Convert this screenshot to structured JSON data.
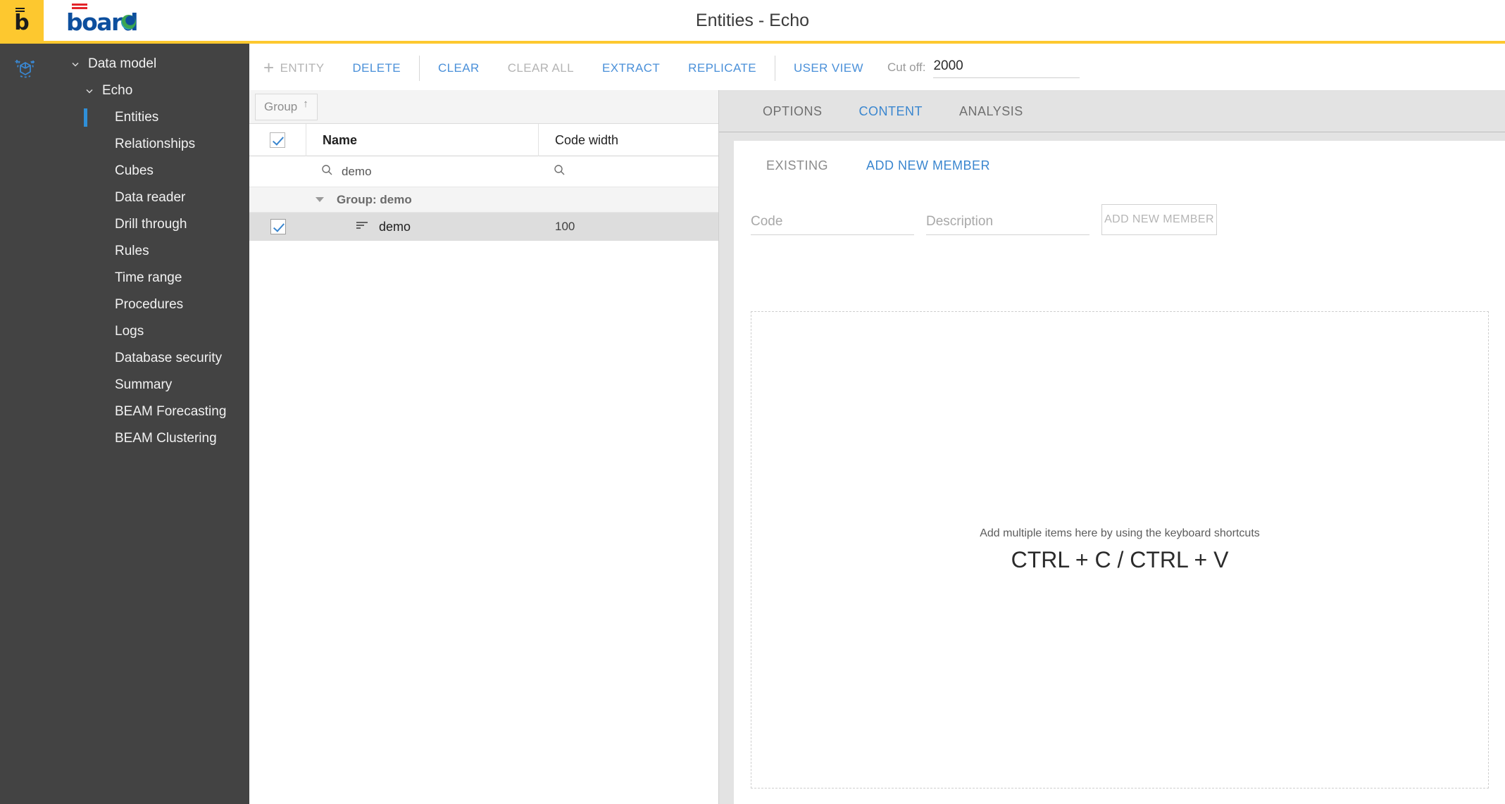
{
  "header": {
    "brand_mark": "b",
    "logo_text": "board",
    "title": "Entities - Echo"
  },
  "colors": {
    "brand_yellow": "#fdc82f",
    "sidebar_bg": "#434343",
    "accent_blue": "#3a86cf",
    "logo_blue": "#0d4f9e",
    "logo_red": "#e3242b",
    "selection_row": "#dddddd"
  },
  "sidebar": {
    "emblem_icon": "cube-sparkle-icon",
    "items": [
      {
        "label": "Data model",
        "level": 0,
        "expanded": true,
        "selected": false
      },
      {
        "label": "Echo",
        "level": 1,
        "expanded": true,
        "selected": false
      },
      {
        "label": "Entities",
        "level": 2,
        "selected": true
      },
      {
        "label": "Relationships",
        "level": 2,
        "selected": false
      },
      {
        "label": "Cubes",
        "level": 2,
        "selected": false
      },
      {
        "label": "Data reader",
        "level": 2,
        "selected": false
      },
      {
        "label": "Drill through",
        "level": 2,
        "selected": false
      },
      {
        "label": "Rules",
        "level": 2,
        "selected": false
      },
      {
        "label": "Time range",
        "level": 2,
        "selected": false
      },
      {
        "label": "Procedures",
        "level": 2,
        "selected": false
      },
      {
        "label": "Logs",
        "level": 2,
        "selected": false
      },
      {
        "label": "Database security",
        "level": 2,
        "selected": false
      },
      {
        "label": "Summary",
        "level": 2,
        "selected": false
      },
      {
        "label": "BEAM Forecasting",
        "level": 2,
        "selected": false
      },
      {
        "label": "BEAM Clustering",
        "level": 2,
        "selected": false
      }
    ]
  },
  "toolbar": {
    "entity_label": "ENTITY",
    "delete_label": "DELETE",
    "clear_label": "CLEAR",
    "clear_all_label": "CLEAR ALL",
    "extract_label": "EXTRACT",
    "replicate_label": "REPLICATE",
    "user_view_label": "USER VIEW",
    "cutoff_label": "Cut off:",
    "cutoff_value": "2000"
  },
  "grid": {
    "group_chip_label": "Group",
    "group_sort_arrow": "↑",
    "columns": [
      "Name",
      "Code width"
    ],
    "filter": {
      "name_value": "demo",
      "code_width_value": ""
    },
    "group_header": "Group: demo",
    "rows": [
      {
        "name": "demo",
        "code_width": "100",
        "checked": true,
        "selected": true,
        "icon": "entity-lines-icon"
      }
    ],
    "header_checkbox_checked": true
  },
  "right_panel": {
    "tabs": [
      {
        "label": "OPTIONS",
        "active": false
      },
      {
        "label": "CONTENT",
        "active": true
      },
      {
        "label": "ANALYSIS",
        "active": false
      }
    ],
    "subtabs": [
      {
        "label": "EXISTING",
        "active": false
      },
      {
        "label": "ADD NEW MEMBER",
        "active": true
      }
    ],
    "form": {
      "code_placeholder": "Code",
      "code_value": "",
      "description_placeholder": "Description",
      "description_value": "",
      "add_button_label": "ADD NEW MEMBER"
    },
    "dropzone": {
      "hint": "Add multiple items here by using the keyboard shortcuts",
      "keys": "CTRL + C / CTRL + V"
    }
  }
}
